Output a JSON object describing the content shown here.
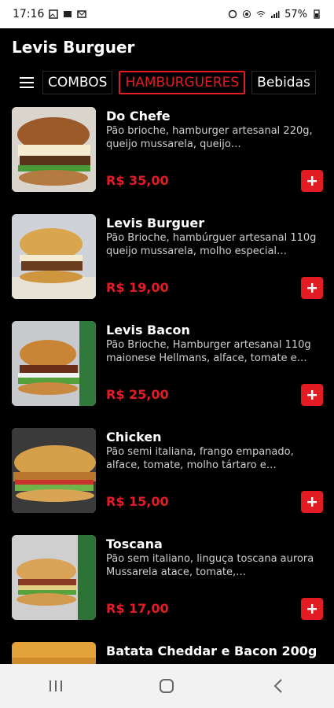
{
  "status": {
    "time": "17:16",
    "battery": "57%"
  },
  "app": {
    "title": "Levis Burguer"
  },
  "tabs": [
    {
      "label": "COMBOS",
      "active": false
    },
    {
      "label": "HAMBURGUERES",
      "active": true
    },
    {
      "label": "Bebidas",
      "active": false
    }
  ],
  "items": [
    {
      "name": "Do Chefe",
      "description": "Pão brioche, hamburger artesanal 220g, queijo mussarela, queijo…",
      "price": "R$ 35,00"
    },
    {
      "name": "Levis Burguer",
      "description": "Pão Brioche, hambúrguer artesanal 110g queijo mussarela, molho especial…",
      "price": "R$ 19,00"
    },
    {
      "name": "Levis Bacon",
      "description": "Pão Brioche, Hamburger artesanal 110g maionese Hellmans, alface, tomate e…",
      "price": "R$ 25,00"
    },
    {
      "name": "Chicken",
      "description": "Pão semi italiana, frango empanado, alface, tomate, molho tártaro e…",
      "price": "R$ 15,00"
    },
    {
      "name": "Toscana",
      "description": "Pão sem italiano, linguça toscana aurora Mussarela atace, tomate,…",
      "price": "R$ 17,00"
    },
    {
      "name": "Batata Cheddar e Bacon 200g",
      "description": "",
      "price": ""
    }
  ],
  "colors": {
    "accent": "#e31b23",
    "background": "#000000"
  },
  "icons": {
    "menu": "hamburger-menu-icon",
    "add": "plus-icon",
    "nav_recents": "recents-icon",
    "nav_home": "home-icon",
    "nav_back": "back-icon"
  }
}
